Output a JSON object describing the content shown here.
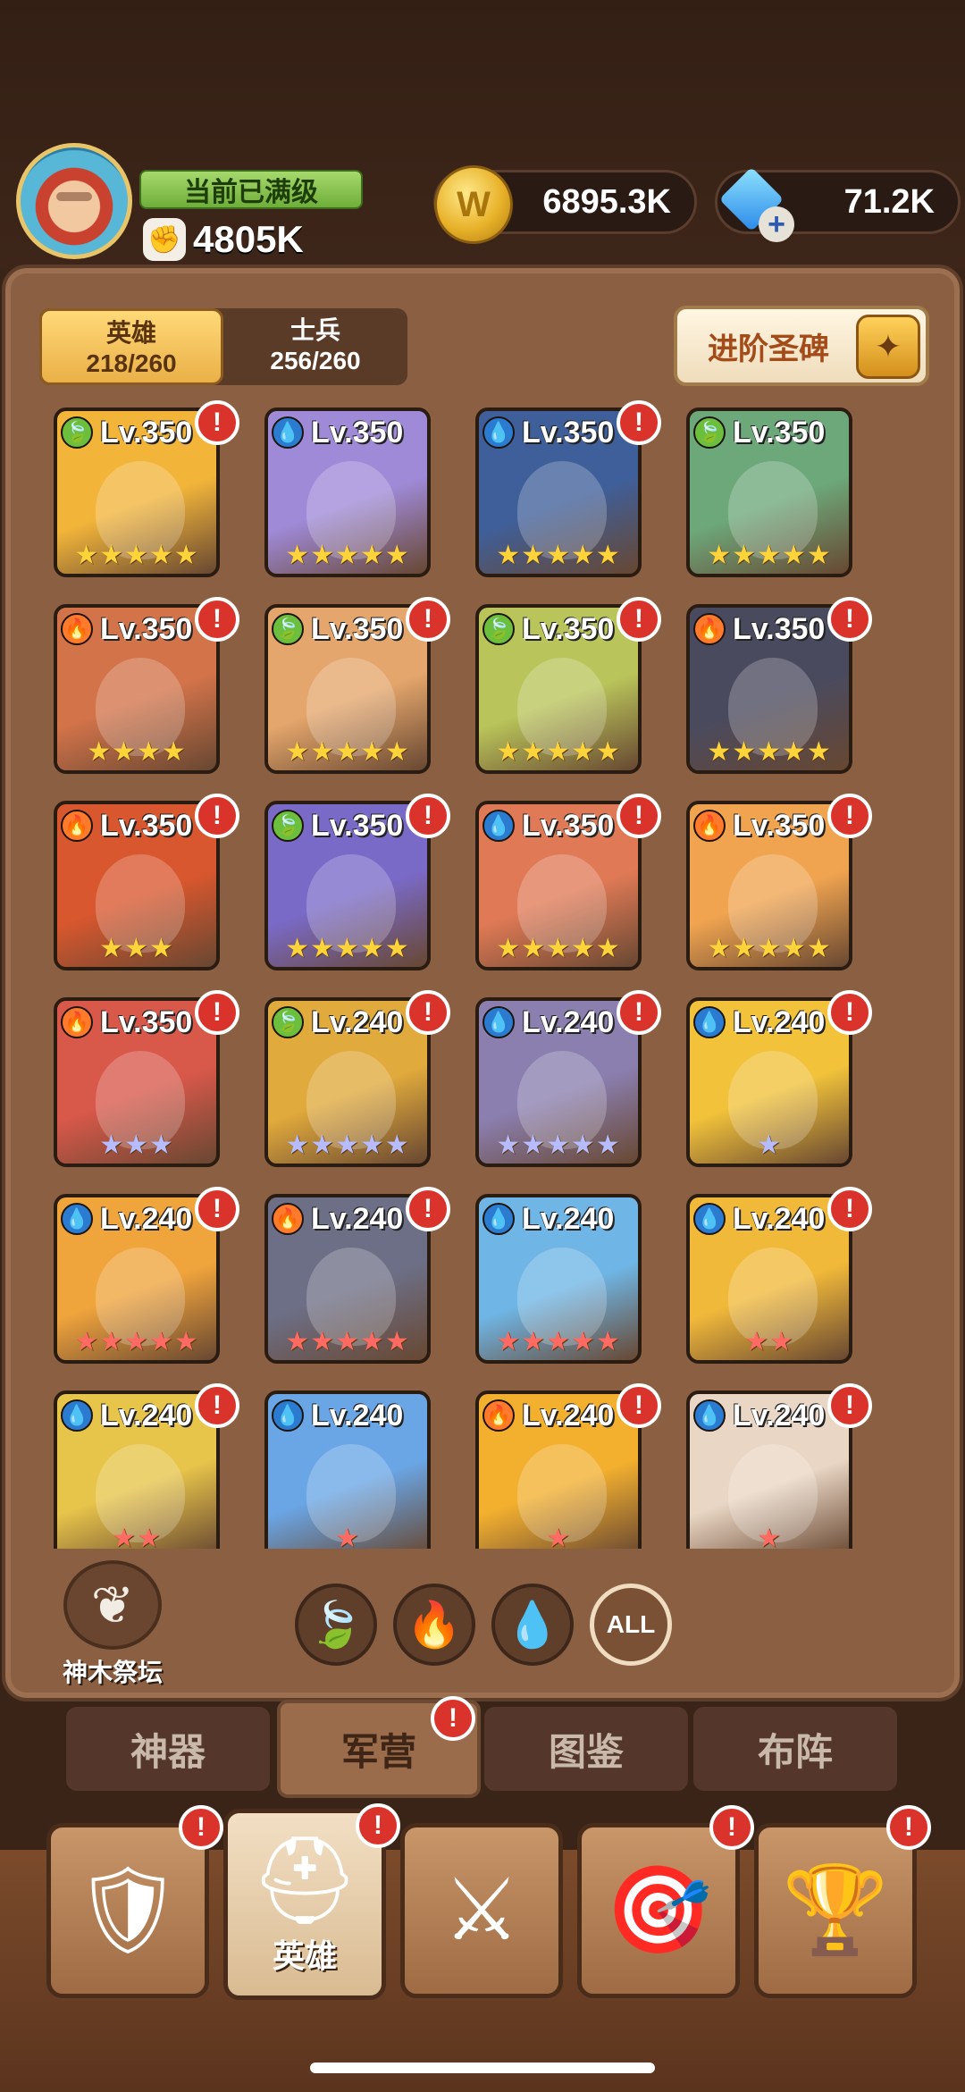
{
  "player": {
    "level_status": "当前已满级",
    "power": "4805K"
  },
  "resources": {
    "gold": "6895.3K",
    "gems": "71.2K",
    "gem_plus": "+"
  },
  "roster_tabs": [
    {
      "label": "英雄",
      "count": "218/260",
      "active": true
    },
    {
      "label": "士兵",
      "count": "256/260",
      "active": false
    }
  ],
  "advance_button": {
    "label": "进阶圣碑"
  },
  "heroes": [
    {
      "level": "Lv.350",
      "element": "leaf",
      "stars": 5,
      "star_color": "gold",
      "alert": true,
      "bg": "#f2b53a"
    },
    {
      "level": "Lv.350",
      "element": "water",
      "stars": 5,
      "star_color": "gold",
      "alert": false,
      "bg": "#9f8ad8"
    },
    {
      "level": "Lv.350",
      "element": "water",
      "stars": 5,
      "star_color": "gold",
      "alert": true,
      "bg": "#3f5f9a"
    },
    {
      "level": "Lv.350",
      "element": "leaf",
      "stars": 5,
      "star_color": "gold",
      "alert": false,
      "bg": "#6da87a"
    },
    {
      "level": "Lv.350",
      "element": "fire",
      "stars": 4,
      "star_color": "gold",
      "alert": true,
      "bg": "#d2734a"
    },
    {
      "level": "Lv.350",
      "element": "leaf",
      "stars": 5,
      "star_color": "gold",
      "alert": true,
      "bg": "#e4a66c"
    },
    {
      "level": "Lv.350",
      "element": "leaf",
      "stars": 5,
      "star_color": "gold",
      "alert": true,
      "bg": "#b9c45a"
    },
    {
      "level": "Lv.350",
      "element": "fire",
      "stars": 5,
      "star_color": "gold",
      "alert": true,
      "bg": "#4a4a5e"
    },
    {
      "level": "Lv.350",
      "element": "fire",
      "stars": 3,
      "star_color": "gold",
      "alert": true,
      "bg": "#d9572e"
    },
    {
      "level": "Lv.350",
      "element": "leaf",
      "stars": 5,
      "star_color": "gold",
      "alert": true,
      "bg": "#7a6ac8"
    },
    {
      "level": "Lv.350",
      "element": "water",
      "stars": 5,
      "star_color": "gold",
      "alert": true,
      "bg": "#e07a56"
    },
    {
      "level": "Lv.350",
      "element": "fire",
      "stars": 5,
      "star_color": "gold",
      "alert": true,
      "bg": "#f0a450"
    },
    {
      "level": "Lv.350",
      "element": "fire",
      "stars": 3,
      "star_color": "blue",
      "alert": true,
      "bg": "#d8584a"
    },
    {
      "level": "Lv.240",
      "element": "leaf",
      "stars": 5,
      "star_color": "blue",
      "alert": true,
      "bg": "#e1aa3c"
    },
    {
      "level": "Lv.240",
      "element": "water",
      "stars": 5,
      "star_color": "blue",
      "alert": true,
      "bg": "#8b7fb0"
    },
    {
      "level": "Lv.240",
      "element": "water",
      "stars": 1,
      "star_color": "blue",
      "alert": true,
      "bg": "#f1c23a"
    },
    {
      "level": "Lv.240",
      "element": "water",
      "stars": 5,
      "star_color": "red",
      "alert": true,
      "bg": "#f0a43c"
    },
    {
      "level": "Lv.240",
      "element": "fire",
      "stars": 5,
      "star_color": "red",
      "alert": true,
      "bg": "#6d6f86"
    },
    {
      "level": "Lv.240",
      "element": "water",
      "stars": 5,
      "star_color": "red",
      "alert": false,
      "bg": "#6fb6e6"
    },
    {
      "level": "Lv.240",
      "element": "water",
      "stars": 2,
      "star_color": "red",
      "alert": true,
      "bg": "#f1b93a"
    },
    {
      "level": "Lv.240",
      "element": "water",
      "stars": 2,
      "star_color": "red",
      "alert": true,
      "bg": "#e7c44a"
    },
    {
      "level": "Lv.240",
      "element": "water",
      "stars": 1,
      "star_color": "red",
      "alert": false,
      "bg": "#6aa6e6"
    },
    {
      "level": "Lv.240",
      "element": "fire",
      "stars": 1,
      "star_color": "red",
      "alert": true,
      "bg": "#f3b02f"
    },
    {
      "level": "Lv.240",
      "element": "water",
      "stars": 1,
      "star_color": "red",
      "alert": true,
      "bg": "#e9d6c4"
    }
  ],
  "altar": {
    "label": "神木祭坛"
  },
  "filters": [
    {
      "name": "leaf",
      "glyph": "🍃"
    },
    {
      "name": "fire",
      "glyph": "🔥"
    },
    {
      "name": "water",
      "glyph": "💧"
    },
    {
      "name": "all",
      "glyph": "ALL"
    }
  ],
  "sub_tabs": [
    {
      "label": "神器",
      "active": false,
      "alert": false
    },
    {
      "label": "军营",
      "active": true,
      "alert": true
    },
    {
      "label": "图鉴",
      "active": false,
      "alert": false
    },
    {
      "label": "布阵",
      "active": false,
      "alert": false
    }
  ],
  "bottom_nav": [
    {
      "name": "banner",
      "glyph": "🛡",
      "label": "",
      "active": false,
      "alert": true
    },
    {
      "name": "heroes",
      "glyph": "⛑",
      "label": "英雄",
      "active": true,
      "alert": true
    },
    {
      "name": "battle",
      "glyph": "⚔",
      "label": "",
      "active": false,
      "alert": false
    },
    {
      "name": "target",
      "glyph": "🎯",
      "label": "",
      "active": false,
      "alert": true
    },
    {
      "name": "trophy",
      "glyph": "🏆",
      "label": "",
      "active": false,
      "alert": true
    }
  ],
  "colors": {
    "panel": "#8a5f42",
    "alert": "#d9332b",
    "leaf": "#6cbf3d",
    "fire": "#ff7a2a",
    "water": "#2b7cd1"
  }
}
